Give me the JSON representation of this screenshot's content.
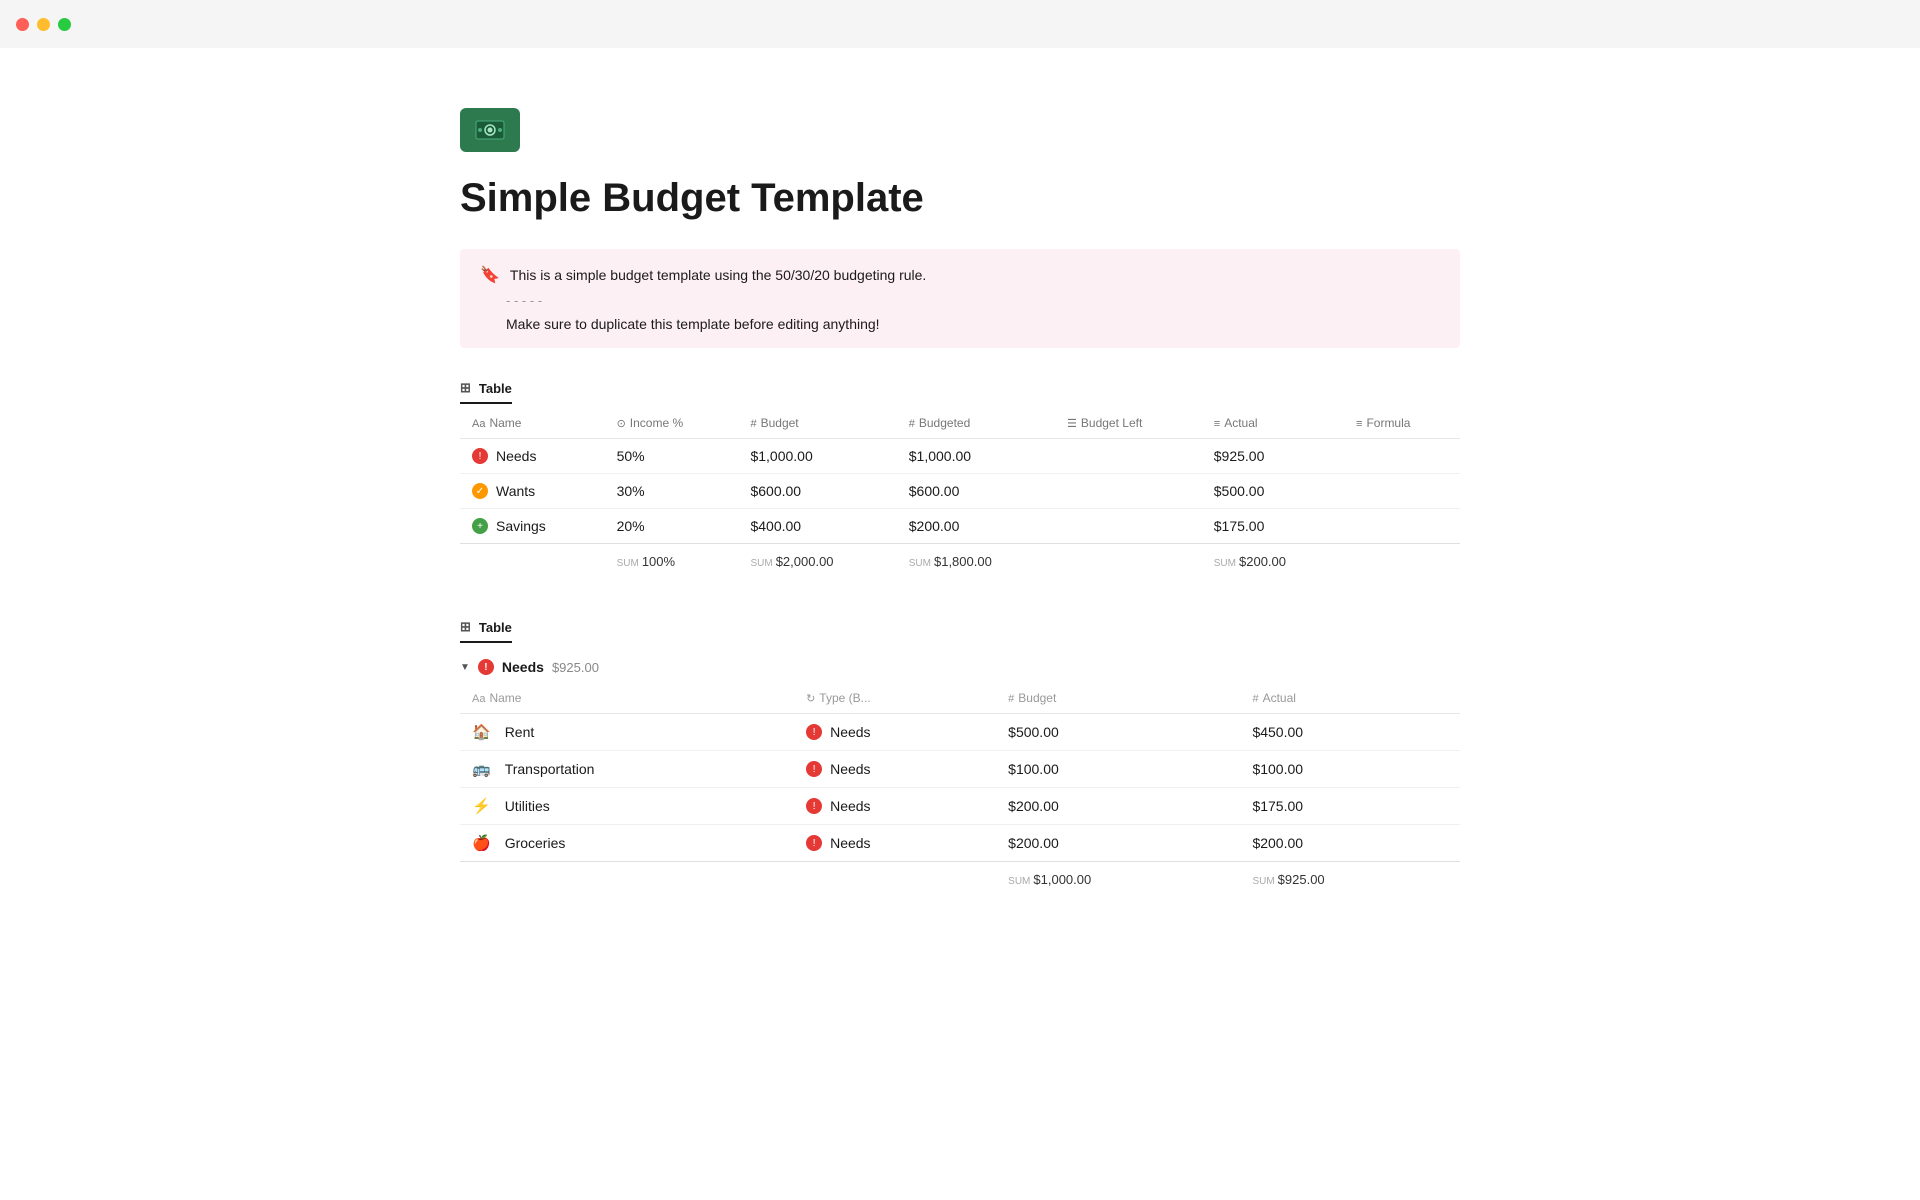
{
  "titlebar": {
    "traffic_lights": [
      "red",
      "yellow",
      "green"
    ]
  },
  "page": {
    "icon_label": "money-icon",
    "title": "Simple Budget Template",
    "callout": {
      "line1": "This is a simple budget template using the 50/30/20 budgeting rule.",
      "divider": "- - - - -",
      "line2": "Make sure to duplicate this template before editing anything!"
    }
  },
  "table1": {
    "label": "Table",
    "columns": [
      {
        "icon": "Aa",
        "name": "Name"
      },
      {
        "icon": "⊙",
        "name": "Income %"
      },
      {
        "icon": "#",
        "name": "Budget"
      },
      {
        "icon": "#",
        "name": "Budgeted"
      },
      {
        "icon": "☰",
        "name": "Budget Left"
      },
      {
        "icon": "≡",
        "name": "Actual"
      },
      {
        "icon": "≡",
        "name": "Formula"
      }
    ],
    "rows": [
      {
        "icon": "red",
        "name": "Needs",
        "income_pct": "50%",
        "budget": "$1,000.00",
        "budgeted": "$1,000.00",
        "budget_left": "",
        "actual": "$925.00",
        "formula": ""
      },
      {
        "icon": "orange",
        "name": "Wants",
        "income_pct": "30%",
        "budget": "$600.00",
        "budgeted": "$600.00",
        "budget_left": "",
        "actual": "$500.00",
        "formula": ""
      },
      {
        "icon": "green",
        "name": "Savings",
        "income_pct": "20%",
        "budget": "$400.00",
        "budgeted": "$200.00",
        "budget_left": "",
        "actual": "$175.00",
        "formula": ""
      }
    ],
    "footer": {
      "income_pct": {
        "label": "SUM",
        "value": "100%"
      },
      "budget": {
        "label": "SUM",
        "value": "$2,000.00"
      },
      "budgeted": {
        "label": "SUM",
        "value": "$1,800.00"
      },
      "actual": {
        "label": "SUM",
        "value": "$200.00"
      }
    }
  },
  "table2": {
    "label": "Table",
    "group": {
      "icon": "red",
      "name": "Needs",
      "sum": "$925.00"
    },
    "columns": [
      {
        "icon": "Aa",
        "name": "Name"
      },
      {
        "icon": "↻",
        "name": "Type (B..."
      },
      {
        "icon": "#",
        "name": "Budget"
      },
      {
        "icon": "#",
        "name": "Actual"
      }
    ],
    "rows": [
      {
        "emoji": "🏠",
        "name": "Rent",
        "type_icon": "red",
        "type": "Needs",
        "budget": "$500.00",
        "actual": "$450.00"
      },
      {
        "emoji": "🚌",
        "name": "Transportation",
        "type_icon": "red",
        "type": "Needs",
        "budget": "$100.00",
        "actual": "$100.00"
      },
      {
        "emoji": "⚡",
        "name": "Utilities",
        "type_icon": "red",
        "type": "Needs",
        "budget": "$200.00",
        "actual": "$175.00"
      },
      {
        "emoji": "🍎",
        "name": "Groceries",
        "type_icon": "red",
        "type": "Needs",
        "budget": "$200.00",
        "actual": "$200.00"
      }
    ],
    "footer": {
      "budget": {
        "label": "SUM",
        "value": "$1,000.00"
      },
      "actual": {
        "label": "SUM",
        "value": "$925.00"
      }
    }
  }
}
